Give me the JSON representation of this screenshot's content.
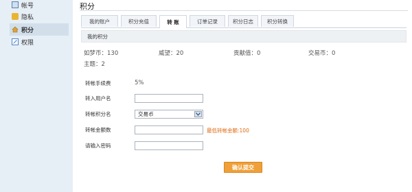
{
  "sidebar": {
    "items": [
      {
        "label": "帐号",
        "icon": "account-icon"
      },
      {
        "label": "隐私",
        "icon": "lock-icon"
      },
      {
        "label": "积分",
        "icon": "home-icon",
        "active": true
      },
      {
        "label": "权限",
        "icon": "edit-icon"
      }
    ]
  },
  "main": {
    "title": "积分",
    "tabs": [
      "我的账户",
      "积分充值",
      "转 账",
      "订单记录",
      "积分日志",
      "积分转换"
    ],
    "active_tab": "转 账",
    "section_title": "我的积分",
    "stats": {
      "rumeng": "如梦币：130",
      "weiwang": "威望：20",
      "gongxian": "贡献值：0",
      "jiaoyi": "交易币：0",
      "zhuti": "主题：2"
    }
  },
  "form": {
    "fee_label": "转帐手续费",
    "fee_value": "5%",
    "to_user_label": "转入用户名",
    "to_user_value": "",
    "points_name_label": "转帐积分名",
    "points_name_selected": "交易币",
    "amount_label": "转帐金额数",
    "amount_value": "",
    "min_hint": "最低转帐金额:100",
    "password_label": "请输入密码",
    "password_value": "",
    "submit_label": "确认提交"
  },
  "colors": {
    "sidebar_bg": "#e6eef6",
    "submit_bg": "#f0a03a",
    "hint_color": "#e06a14"
  }
}
